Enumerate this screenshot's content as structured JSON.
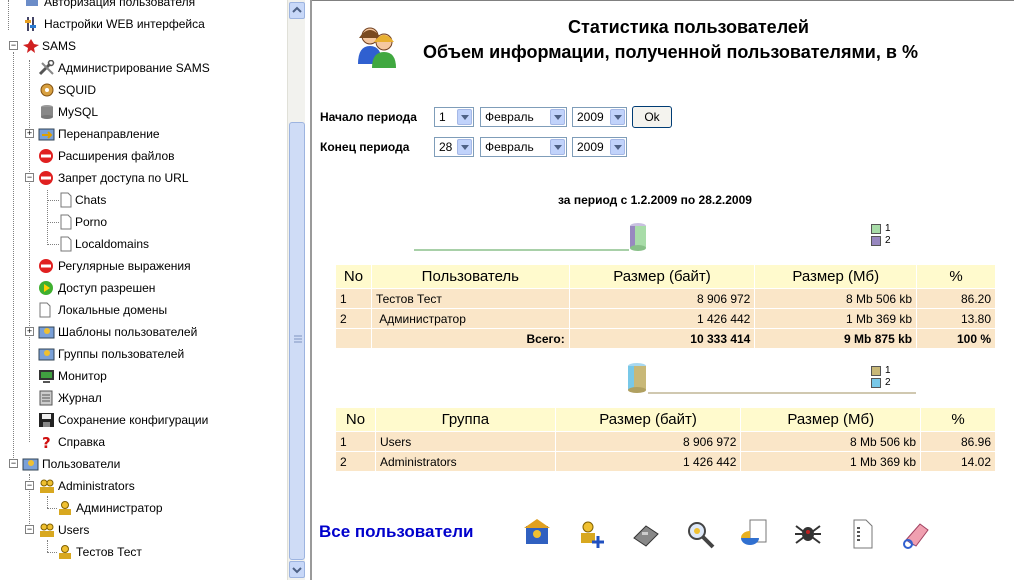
{
  "tree": {
    "items": [
      {
        "label": "Авторизация пользователя"
      },
      {
        "label": "Настройки WEB интерфейса"
      },
      {
        "label": "SAMS"
      },
      {
        "label": "Администрирование SAMS"
      },
      {
        "label": "SQUID"
      },
      {
        "label": "MySQL"
      },
      {
        "label": "Перенаправление"
      },
      {
        "label": "Расширения файлов"
      },
      {
        "label": "Запрет доступа по URL"
      },
      {
        "label": "Chats"
      },
      {
        "label": "Porno"
      },
      {
        "label": "Localdomains"
      },
      {
        "label": "Регулярные выражения"
      },
      {
        "label": "Доступ разрешен"
      },
      {
        "label": "Локальные домены"
      },
      {
        "label": "Шаблоны пользователей"
      },
      {
        "label": "Группы пользователей"
      },
      {
        "label": "Монитор"
      },
      {
        "label": "Журнал"
      },
      {
        "label": "Сохранение конфигурации"
      },
      {
        "label": "Справка"
      },
      {
        "label": "Пользователи"
      },
      {
        "label": "Administrators"
      },
      {
        "label": "Администратор"
      },
      {
        "label": "Users"
      },
      {
        "label": "Тестов Тест"
      }
    ]
  },
  "main": {
    "title_line1": "Статистика пользователей",
    "title_line2": "Объем информации, полученной пользователями, в %",
    "form": {
      "start_label": "Начало периода",
      "end_label": "Конец периода",
      "start_day": "1",
      "start_month": "Февраль",
      "start_year": "2009",
      "end_day": "28",
      "end_month": "Февраль",
      "end_year": "2009",
      "ok_label": "Ok"
    },
    "period_text": "за период с 1.2.2009 по 28.2.2009",
    "users_legend": [
      "1",
      "2"
    ],
    "users_table": {
      "headers": [
        "No",
        "Пользователь",
        "Размер (байт)",
        "Размер (Мб)",
        "%"
      ],
      "rows": [
        [
          "1",
          "Тестов Тест",
          "8 906 972",
          "8 Mb 506 kb",
          "86.20"
        ],
        [
          "2",
          " Администратор",
          "1 426 442",
          "1 Mb 369 kb",
          "13.80"
        ]
      ],
      "total": [
        "Всего:",
        "10 333 414",
        "9 Mb 875 kb",
        "100 %"
      ]
    },
    "groups_legend": [
      "1",
      "2"
    ],
    "groups_table": {
      "headers": [
        "No",
        "Группа",
        "Размер (байт)",
        "Размер (Мб)",
        "%"
      ],
      "rows": [
        [
          "1",
          "Users",
          "8 906 972",
          "8 Mb 506 kb",
          "86.96"
        ],
        [
          "2",
          "Administrators",
          "1 426 442",
          "1 Mb 369 kb",
          "14.02"
        ]
      ]
    },
    "all_users_label": "Все пользователи"
  },
  "colors": {
    "table_header": "#fffacd",
    "table_row": "#fae6c8",
    "link_blue": "#0000cc",
    "users_series1": "#a8dca8",
    "users_series2": "#9888c0",
    "groups_series1": "#c8b878",
    "groups_series2": "#78c8e8"
  },
  "icons": [
    "home-users-icon",
    "add-user-icon",
    "calculator-icon",
    "search-icon",
    "pie-chart-icon",
    "spider-icon",
    "document-icon",
    "eraser-icon"
  ]
}
